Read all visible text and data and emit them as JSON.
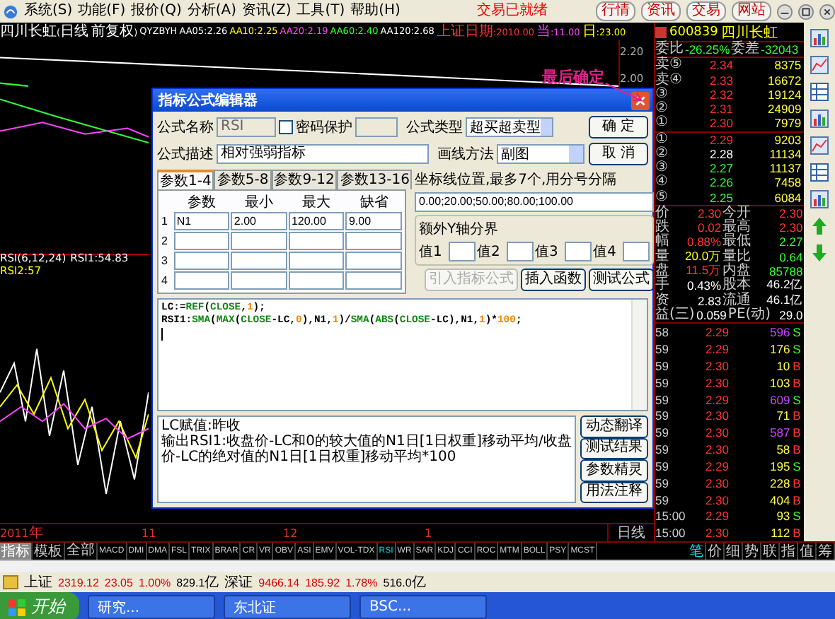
{
  "menu": {
    "items": [
      "系统(S)",
      "功能(F)",
      "报价(Q)",
      "分析(A)",
      "资讯(Z)",
      "工具(T)",
      "帮助(H)"
    ],
    "status": "交易已就绪",
    "nav_buttons": [
      "行情",
      "资讯",
      "交易",
      "网站"
    ]
  },
  "chart": {
    "info": [
      {
        "text": "四川长虹(日线 前复权)",
        "color": "#ffffff"
      },
      {
        "text": "QYZBYH",
        "color": "#ffffff"
      },
      {
        "text": "AA05:2.26",
        "color": "#ffffff"
      },
      {
        "text": "AA10:2.25",
        "color": "#ffff00"
      },
      {
        "text": "AA20:2.19",
        "color": "#ff44ff"
      },
      {
        "text": "AA60:2.40",
        "color": "#33ff33"
      },
      {
        "text": "AA120:2.68",
        "color": "#ffffff"
      },
      {
        "text": "上证日期:2010.00",
        "color": "#ff3333"
      },
      {
        "text": "当:11.00",
        "color": "#ff44ff"
      },
      {
        "text": "日:23.00",
        "color": "#ffff00"
      }
    ],
    "rsi_label": [
      {
        "text": "RSI(6,12,24)",
        "color": "#ffffff"
      },
      {
        "text": "RSI1:54.83",
        "color": "#ffffff"
      },
      {
        "text": "RSI2:57",
        "color": "#ffff00"
      }
    ],
    "axis_labels": [
      "2.20",
      "2.00"
    ],
    "date_labels": [
      "2011年",
      "11",
      "12",
      "1"
    ],
    "period": "日线"
  },
  "quote": {
    "code": "600839",
    "name": "四川长虹",
    "ratio_label": "委比",
    "ratio": "-26.25%",
    "diff_label": "委差",
    "diff": "-32043",
    "levels": [
      {
        "label": "卖⑤",
        "price": "2.34",
        "volume": "8375",
        "color": "#ff3333"
      },
      {
        "label": "卖④",
        "price": "2.33",
        "volume": "16672",
        "color": "#ff3333"
      },
      {
        "label": "③",
        "price": "2.32",
        "volume": "19124",
        "color": "#ff3333"
      },
      {
        "label": "②",
        "price": "2.31",
        "volume": "24909",
        "color": "#ff3333"
      },
      {
        "label": "①",
        "price": "2.30",
        "volume": "7979",
        "color": "#ff3333"
      },
      {
        "label": "①",
        "price": "2.29",
        "volume": "9203",
        "color": "#ff3333"
      },
      {
        "label": "②",
        "price": "2.28",
        "volume": "11134",
        "color": "#ffffff"
      },
      {
        "label": "③",
        "price": "2.27",
        "volume": "11137",
        "color": "#33ff33"
      },
      {
        "label": "④",
        "price": "2.26",
        "volume": "7458",
        "color": "#33ff33"
      },
      {
        "label": "⑤",
        "price": "2.25",
        "volume": "6084",
        "color": "#33ff33"
      }
    ],
    "stats": [
      {
        "left": {
          "label": "价",
          "value": "2.30",
          "color": "#ff3333"
        },
        "right": {
          "label": "今开",
          "value": "2.30",
          "color": "#ff3333"
        }
      },
      {
        "left": {
          "label": "跌",
          "value": "0.02",
          "color": "#ff3333"
        },
        "right": {
          "label": "最高",
          "value": "2.30",
          "color": "#ff3333"
        }
      },
      {
        "left": {
          "label": "幅",
          "value": "0.88%",
          "color": "#ff3333"
        },
        "right": {
          "label": "最低",
          "value": "2.27",
          "color": "#33ff33"
        }
      },
      {
        "left": {
          "label": "量",
          "value": "20.0万",
          "color": "#ffff00"
        },
        "right": {
          "label": "量比",
          "value": "0.64",
          "color": "#33ff33"
        }
      },
      {
        "left": {
          "label": "盘",
          "value": "11.5万",
          "color": "#ff3333"
        },
        "right": {
          "label": "内盘",
          "value": "85788",
          "color": "#33ff33"
        }
      },
      {
        "left": {
          "label": "手",
          "value": "0.43%",
          "color": "#ffffff"
        },
        "right": {
          "label": "股本",
          "value": "46.2亿",
          "color": "#ffffff"
        }
      },
      {
        "left": {
          "label": "资",
          "value": "2.83",
          "color": "#ffffff"
        },
        "right": {
          "label": "流通",
          "value": "46.1亿",
          "color": "#ffffff"
        }
      },
      {
        "left": {
          "label": "益(三)",
          "value": "0.059",
          "color": "#ffffff"
        },
        "right": {
          "label": "PE(动)",
          "value": "29.0",
          "color": "#ffffff"
        }
      }
    ],
    "ticks": [
      {
        "time": "58",
        "price": "2.29",
        "volume": "596",
        "large": true,
        "side": "S"
      },
      {
        "time": "59",
        "price": "2.29",
        "volume": "176",
        "large": false,
        "side": "S"
      },
      {
        "time": "59",
        "price": "2.30",
        "volume": "10",
        "large": false,
        "side": "B"
      },
      {
        "time": "59",
        "price": "2.30",
        "volume": "103",
        "large": false,
        "side": "B"
      },
      {
        "time": "59",
        "price": "2.29",
        "volume": "609",
        "large": true,
        "side": "S"
      },
      {
        "time": "59",
        "price": "2.30",
        "volume": "71",
        "large": false,
        "side": "B"
      },
      {
        "time": "59",
        "price": "2.30",
        "volume": "587",
        "large": true,
        "side": "B"
      },
      {
        "time": "59",
        "price": "2.30",
        "volume": "58",
        "large": false,
        "side": "B"
      },
      {
        "time": "59",
        "price": "2.29",
        "volume": "195",
        "large": false,
        "side": "S"
      },
      {
        "time": "59",
        "price": "2.30",
        "volume": "228",
        "large": false,
        "side": "B"
      },
      {
        "time": "59",
        "price": "2.30",
        "volume": "404",
        "large": false,
        "side": "B"
      },
      {
        "time": "15:00",
        "price": "2.29",
        "volume": "93",
        "large": false,
        "side": "S"
      },
      {
        "time": "15:00",
        "price": "2.30",
        "volume": "112",
        "large": false,
        "side": "B"
      }
    ]
  },
  "mode_tabs": [
    {
      "label": "指标",
      "selected": true
    },
    {
      "label": "模板",
      "selected": false
    }
  ],
  "indicator_tabs": [
    {
      "label": "全部",
      "selected": false
    },
    {
      "label": "MACD",
      "selected": false
    },
    {
      "label": "DMI",
      "selected": false
    },
    {
      "label": "DMA",
      "selected": false
    },
    {
      "label": "FSL",
      "selected": false
    },
    {
      "label": "TRIX",
      "selected": false
    },
    {
      "label": "BRAR",
      "selected": false
    },
    {
      "label": "CR",
      "selected": false
    },
    {
      "label": "VR",
      "selected": false
    },
    {
      "label": "OBV",
      "selected": false
    },
    {
      "label": "ASI",
      "selected": false
    },
    {
      "label": "EMV",
      "selected": false
    },
    {
      "label": "VOL-TDX",
      "selected": false
    },
    {
      "label": "RSI",
      "selected": true
    },
    {
      "label": "WR",
      "selected": false
    },
    {
      "label": "SAR",
      "selected": false
    },
    {
      "label": "KDJ",
      "selected": false
    },
    {
      "label": "CCI",
      "selected": false
    },
    {
      "label": "ROC",
      "selected": false
    },
    {
      "label": "MTM",
      "selected": false
    },
    {
      "label": "BOLL",
      "selected": false
    },
    {
      "label": "PSY",
      "selected": false
    },
    {
      "label": "MCST",
      "selected": false
    }
  ],
  "view_tabs": [
    {
      "label": "笔",
      "selected": true
    },
    {
      "label": "价",
      "selected": false
    },
    {
      "label": "细",
      "selected": false
    },
    {
      "label": "势",
      "selected": false
    },
    {
      "label": "联",
      "selected": false
    },
    {
      "label": "指",
      "selected": false
    },
    {
      "label": "值",
      "selected": false
    },
    {
      "label": "筹",
      "selected": false
    }
  ],
  "status_bar": [
    {
      "text": "上证",
      "color": "#000000"
    },
    {
      "text": "2319.12",
      "color": "#dd0000"
    },
    {
      "text": "23.05",
      "color": "#dd0000"
    },
    {
      "text": "1.00%",
      "color": "#dd0000"
    },
    {
      "text": "829.1亿",
      "color": "#000000"
    },
    {
      "text": "深证",
      "color": "#000000"
    },
    {
      "text": "9466.14",
      "color": "#dd0000"
    },
    {
      "text": "185.92",
      "color": "#dd0000"
    },
    {
      "text": "1.78%",
      "color": "#dd0000"
    },
    {
      "text": "516.0亿",
      "color": "#000000"
    }
  ],
  "taskbar": {
    "start": "开始",
    "items": [
      "研究...",
      "东北证",
      "BSC..."
    ]
  },
  "annotation": "最后确定",
  "dialog": {
    "title": "指标公式编辑器",
    "name_label": "公式名称",
    "name_field": {
      "value": "RSI",
      "disabled": true
    },
    "password_protect": {
      "label": "密码保护",
      "checked": false
    },
    "type_label": "公式类型",
    "type_value": "超买超卖型",
    "desc_label": "公式描述",
    "desc_value": "相对强弱指标",
    "draw_label": "画线方法",
    "draw_value": "副图",
    "ok": "确  定",
    "cancel": "取  消",
    "param_tabs": [
      {
        "label": "参数1-4",
        "selected": true
      },
      {
        "label": "参数5-8",
        "selected": false
      },
      {
        "label": "参数9-12",
        "selected": false
      },
      {
        "label": "参数13-16",
        "selected": false
      }
    ],
    "param_columns": [
      "参数",
      "最小",
      "最大",
      "缺省"
    ],
    "param_rows": [
      {
        "index": "1",
        "values": [
          "N1",
          "2.00",
          "120.00",
          "9.00"
        ]
      },
      {
        "index": "2"
      },
      {
        "index": "3"
      },
      {
        "index": "4"
      }
    ],
    "axis_label": "坐标线位置,最多7个,用分号分隔",
    "axis_value": "0.00;20.00;50.00;80.00;100.00",
    "extra_axis_title": "额外Y轴分界",
    "extra_axis_labels": [
      "值1",
      "值2",
      "值3",
      "值4"
    ],
    "action_buttons": [
      {
        "label": "引入指标公式",
        "disabled": true
      },
      {
        "label": "插入函数",
        "disabled": false
      },
      {
        "label": "测试公式",
        "disabled": false
      }
    ],
    "code": [
      [
        {
          "t": "LC:=",
          "kind": "plain"
        },
        {
          "t": "REF",
          "kind": "func"
        },
        {
          "t": "(",
          "kind": "plain"
        },
        {
          "t": "CLOSE",
          "kind": "func"
        },
        {
          "t": ",",
          "kind": "plain"
        },
        {
          "t": "1",
          "kind": "num"
        },
        {
          "t": ");",
          "kind": "plain"
        }
      ],
      [
        {
          "t": "RSI1:",
          "kind": "plain"
        },
        {
          "t": "SMA",
          "kind": "func"
        },
        {
          "t": "(",
          "kind": "plain"
        },
        {
          "t": "MAX",
          "kind": "func"
        },
        {
          "t": "(",
          "kind": "plain"
        },
        {
          "t": "CLOSE",
          "kind": "func"
        },
        {
          "t": "-LC,",
          "kind": "plain"
        },
        {
          "t": "0",
          "kind": "num"
        },
        {
          "t": "),N1,",
          "kind": "plain"
        },
        {
          "t": "1",
          "kind": "num"
        },
        {
          "t": ")/",
          "kind": "plain"
        },
        {
          "t": "SMA",
          "kind": "func"
        },
        {
          "t": "(",
          "kind": "plain"
        },
        {
          "t": "ABS",
          "kind": "func"
        },
        {
          "t": "(",
          "kind": "plain"
        },
        {
          "t": "CLOSE",
          "kind": "func"
        },
        {
          "t": "-LC),N1,",
          "kind": "plain"
        },
        {
          "t": "1",
          "kind": "num"
        },
        {
          "t": ")*",
          "kind": "plain"
        },
        {
          "t": "100",
          "kind": "num"
        },
        {
          "t": ";",
          "kind": "plain"
        }
      ]
    ],
    "notes": [
      "LC赋值:昨收",
      "输出RSI1:收盘价-LC和0的较大值的N1日[1日权重]移动平均/收盘价-LC的绝对值的N1日[1日权重]移动平均*100"
    ],
    "side_buttons": [
      "动态翻译",
      "测试结果",
      "参数精灵",
      "用法注释"
    ]
  }
}
